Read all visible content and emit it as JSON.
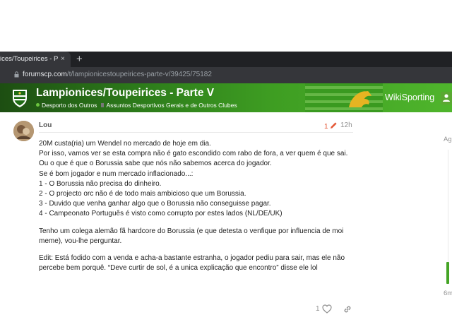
{
  "browser": {
    "tab_title": "ices/Toupeirices - Parte",
    "tab_close": "×",
    "new_tab": "+",
    "url_host": "forumscp.com",
    "url_path": "/t/lampionicestoupeirices-parte-v/39425/75182"
  },
  "header": {
    "title": "Lampionices/Toupeirices - Parte V",
    "category": "Desporto dos Outros",
    "subcategory": "Assuntos Desportivos Gerais e de Outros Clubes",
    "brand": "WikiSporting",
    "colors": {
      "primary": "#2c7a1a",
      "accent": "#6cc43f"
    }
  },
  "post": {
    "author": "Lou",
    "edit_count": "1",
    "age": "12h",
    "paragraphs": [
      "20M custa(ria) um Wendel no mercado de hoje em dia.",
      "Tenho um colega alemão fã hardcore do Borussia (e que detesta o venfique por influencia de moi meme), vou-lhe perguntar.",
      "Edit: Está fodido com a venda e acha-a bastante estranha, o jogador pediu para sair, mas ele não percebe bem porquê. “Deve curtir de sol, é a unica explicação que encontro” disse ele lol"
    ],
    "lines": [
      "Por isso, vamos ver se esta compra não é gato escondido com rabo de fora, a ver quem é que sai.",
      "Ou o que é que o Borussia sabe que nós não sabemos acerca do jogador.",
      "Se é bom jogador e num mercado inflacionado...:",
      "1 - O Borussia não precisa do dinheiro.",
      "2 - O projecto orc não é de todo mais ambicioso que um Borussia.",
      "3 - Duvido que venha ganhar algo que o Borussia não conseguisse pagar.",
      "4 - Campeonato Português é visto como corrupto por estes lados (NL/DE/UK)"
    ],
    "like_count": "1"
  },
  "timeline": {
    "top_label": "Ag",
    "bottom_label": "6m"
  }
}
